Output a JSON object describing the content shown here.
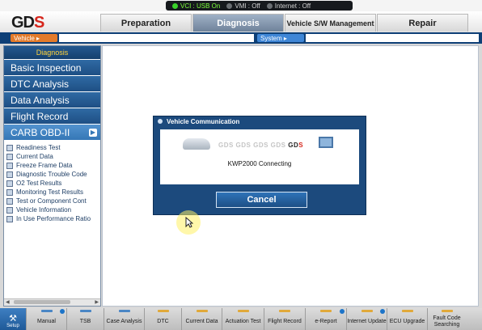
{
  "status": {
    "vci": "VCI : USB On",
    "vmi": "VMI : Off",
    "internet": "Internet : Off"
  },
  "logo": {
    "text_main": "GD",
    "text_accent": "S"
  },
  "nav": {
    "tabs": [
      {
        "label": "Preparation"
      },
      {
        "label": "Diagnosis"
      },
      {
        "label": "Vehicle S/W Management"
      },
      {
        "label": "Repair"
      }
    ],
    "active_tab": "Diagnosis"
  },
  "info": {
    "vehicle_label": "Vehicle ▸",
    "vehicle_value": "",
    "system_label": "System ▸",
    "system_value": ""
  },
  "sidebar": {
    "title": "Diagnosis",
    "menu": [
      {
        "label": "Basic Inspection"
      },
      {
        "label": "DTC Analysis"
      },
      {
        "label": "Data Analysis"
      },
      {
        "label": "Flight Record"
      },
      {
        "label": "CARB OBD-II"
      }
    ],
    "carb_arrow": "▶",
    "sub_items": [
      {
        "label": "Readiness Test"
      },
      {
        "label": "Current Data"
      },
      {
        "label": "Freeze Frame Data"
      },
      {
        "label": "Diagnostic Trouble Code"
      },
      {
        "label": "O2 Test Results"
      },
      {
        "label": "Monitoring Test Results"
      },
      {
        "label": "Test or Component Cont"
      },
      {
        "label": "Vehicle Information"
      },
      {
        "label": "In Use Performance Ratio"
      }
    ]
  },
  "dialog": {
    "title": "Vehicle Communication",
    "chain_text": "GDS GDS GDS GDS",
    "chain_logo_main": "GD",
    "chain_logo_accent": "S",
    "message": "KWP2000 Connecting",
    "cancel_label": "Cancel"
  },
  "toolbar": {
    "setup_label": "Setup",
    "buttons": [
      {
        "label": "Manual",
        "mark_color": "#4a86c5",
        "badge": true
      },
      {
        "label": "TSB",
        "mark_color": "#4a86c5",
        "badge": false
      },
      {
        "label": "Case Analysis",
        "mark_color": "#4a86c5",
        "badge": false
      },
      {
        "label": "DTC",
        "mark_color": "#e1a93a",
        "badge": false
      },
      {
        "label": "Current Data",
        "mark_color": "#e1a93a",
        "badge": false
      },
      {
        "label": "Actuation Test",
        "mark_color": "#e1a93a",
        "badge": false
      },
      {
        "label": "Flight Record",
        "mark_color": "#e1a93a",
        "badge": false
      },
      {
        "label": "e-Report",
        "mark_color": "#e1a93a",
        "badge": true
      },
      {
        "label": "Internet Update",
        "mark_color": "#e1a93a",
        "badge": true
      },
      {
        "label": "ECU Upgrade",
        "mark_color": "#e1a93a",
        "badge": false
      },
      {
        "label": "Fault Code Searching",
        "mark_color": "#e1a93a",
        "badge": false
      }
    ]
  }
}
